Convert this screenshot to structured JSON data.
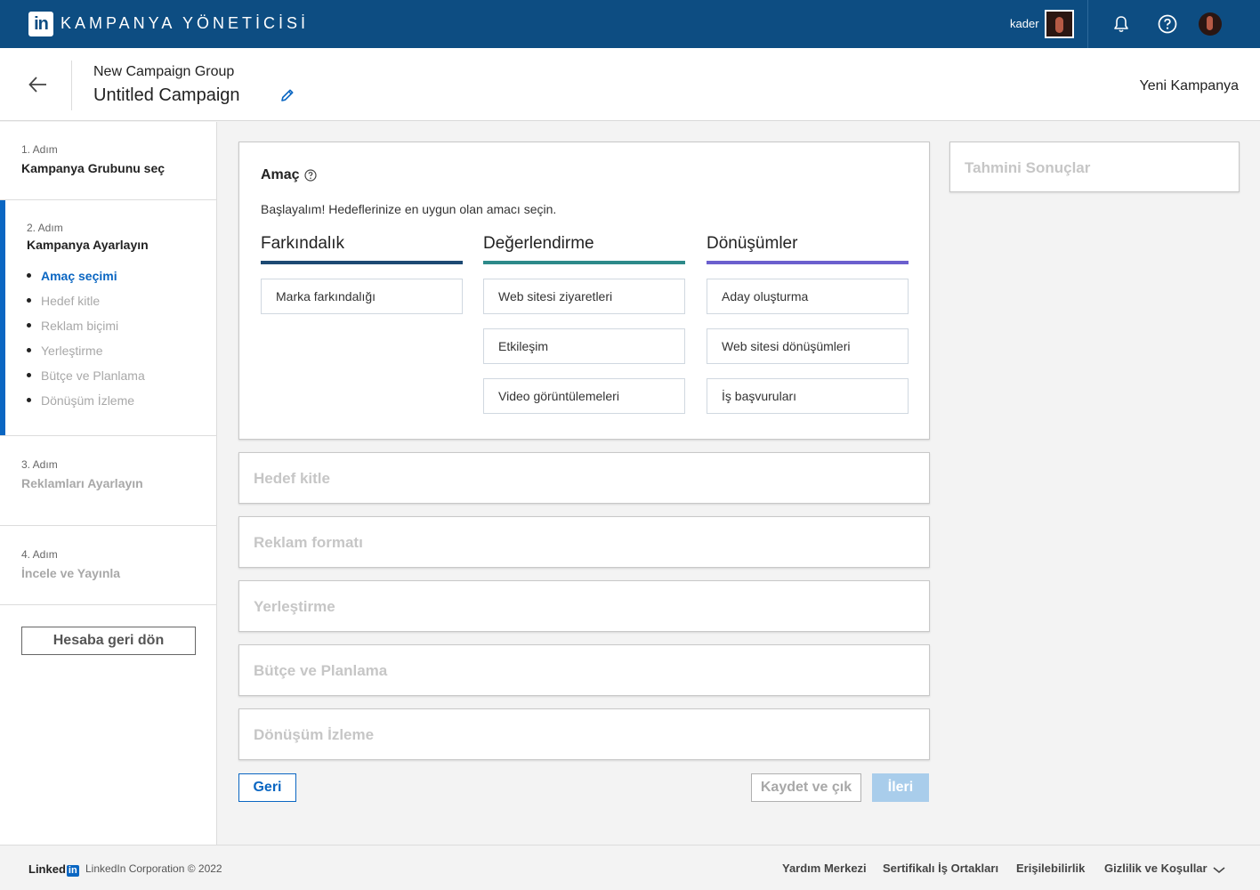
{
  "topbar": {
    "logo_text": "in",
    "title": "KAMPANYA YÖNETİCİSİ",
    "user_name": "kader",
    "icons": [
      "bell-icon",
      "help-icon"
    ],
    "colors": {
      "bar": "#0d4d82"
    }
  },
  "header": {
    "group_name": "New Campaign Group",
    "campaign_name": "Untitled Campaign",
    "new_campaign_label": "Yeni Kampanya"
  },
  "sidebar": {
    "steps": [
      {
        "number": "1. Adım",
        "title": "Kampanya Grubunu seç",
        "state": "done"
      },
      {
        "number": "2. Adım",
        "title": "Kampanya Ayarlayın",
        "state": "active",
        "substeps": [
          "Amaç seçimi",
          "Hedef kitle",
          "Reklam biçimi",
          "Yerleştirme",
          "Bütçe ve Planlama",
          "Dönüşüm İzleme"
        ],
        "active_substep": "Amaç seçimi"
      },
      {
        "number": "3. Adım",
        "title": "Reklamları Ayarlayın",
        "state": "pending"
      },
      {
        "number": "4. Adım",
        "title": "İncele ve Yayınla",
        "state": "pending"
      }
    ],
    "return_button": "Hesaba geri dön"
  },
  "objective": {
    "title": "Amaç",
    "subtitle": "Başlayalım! Hedeflerinize en uygun olan amacı seçin.",
    "columns": [
      {
        "title": "Farkındalık",
        "color": "#1d4a73",
        "options": [
          "Marka farkındalığı"
        ]
      },
      {
        "title": "Değerlendirme",
        "color": "#2d8a8a",
        "options": [
          "Web sitesi ziyaretleri",
          "Etkileşim",
          "Video görüntülemeleri"
        ]
      },
      {
        "title": "Dönüşümler",
        "color": "#6b5fce",
        "options": [
          "Aday oluşturma",
          "Web sitesi dönüşümleri",
          "İş başvuruları"
        ]
      }
    ]
  },
  "sections": [
    "Hedef kitle",
    "Reklam formatı",
    "Yerleştirme",
    "Bütçe ve Planlama",
    "Dönüşüm İzleme"
  ],
  "results": {
    "title": "Tahmini Sonuçlar"
  },
  "actions": {
    "back": "Geri",
    "save_exit": "Kaydet ve çık",
    "next": "İleri"
  },
  "footer": {
    "brand": "Linked",
    "brand_in": "in",
    "copyright": "LinkedIn Corporation © 2022",
    "links": [
      "Yardım Merkezi",
      "Sertifikalı İş Ortakları",
      "Erişilebilirlik",
      "Gizlilik ve Koşullar"
    ]
  }
}
